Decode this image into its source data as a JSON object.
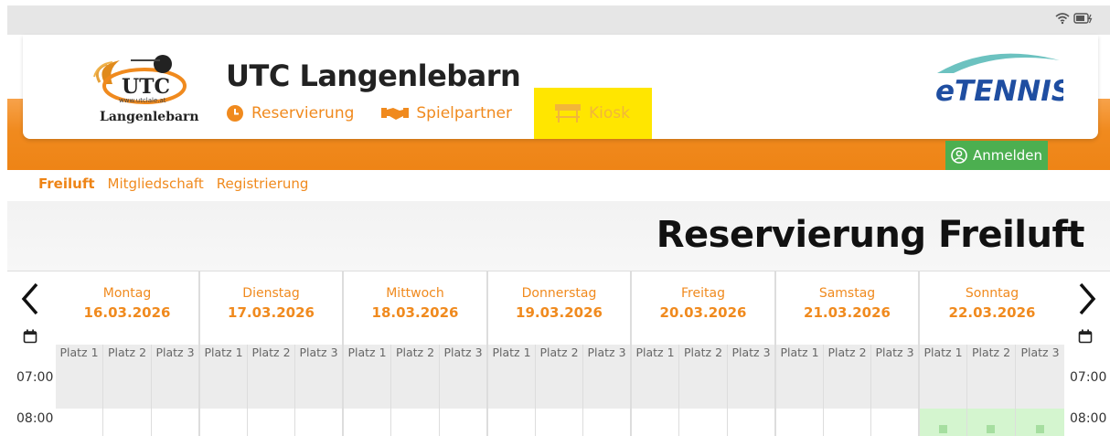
{
  "club": {
    "name": "UTC Langenlebarn",
    "logo_top": "UTC",
    "logo_url": "www.utclale.at",
    "logo_bottom": "Langenlebarn"
  },
  "brand": {
    "etennis": "eTENNIS"
  },
  "colors": {
    "accent": "#f08a1e",
    "login": "#4caf50",
    "kiosk_highlight": "#ffe600",
    "available": "#d4f5cf"
  },
  "nav": [
    {
      "label": "Reservierung",
      "icon": "clock-icon"
    },
    {
      "label": "Spielpartner",
      "icon": "handshake-icon"
    },
    {
      "label": "Kiosk",
      "icon": "kiosk-stand-icon"
    }
  ],
  "login": {
    "label": "Anmelden",
    "icon": "user-circle-icon"
  },
  "subnav": [
    {
      "label": "Freiluft",
      "active": true
    },
    {
      "label": "Mitgliedschaft",
      "active": false
    },
    {
      "label": "Registrierung",
      "active": false
    }
  ],
  "page": {
    "title": "Reservierung Freiluft"
  },
  "calendar": {
    "days": [
      {
        "name": "Montag",
        "date": "16.03.2026"
      },
      {
        "name": "Dienstag",
        "date": "17.03.2026"
      },
      {
        "name": "Mittwoch",
        "date": "18.03.2026"
      },
      {
        "name": "Donnerstag",
        "date": "19.03.2026"
      },
      {
        "name": "Freitag",
        "date": "20.03.2026"
      },
      {
        "name": "Samstag",
        "date": "21.03.2026"
      },
      {
        "name": "Sonntag",
        "date": "22.03.2026"
      }
    ],
    "courts": [
      "Platz 1",
      "Platz 2",
      "Platz 3"
    ],
    "times": [
      "07:00",
      "08:00"
    ]
  }
}
